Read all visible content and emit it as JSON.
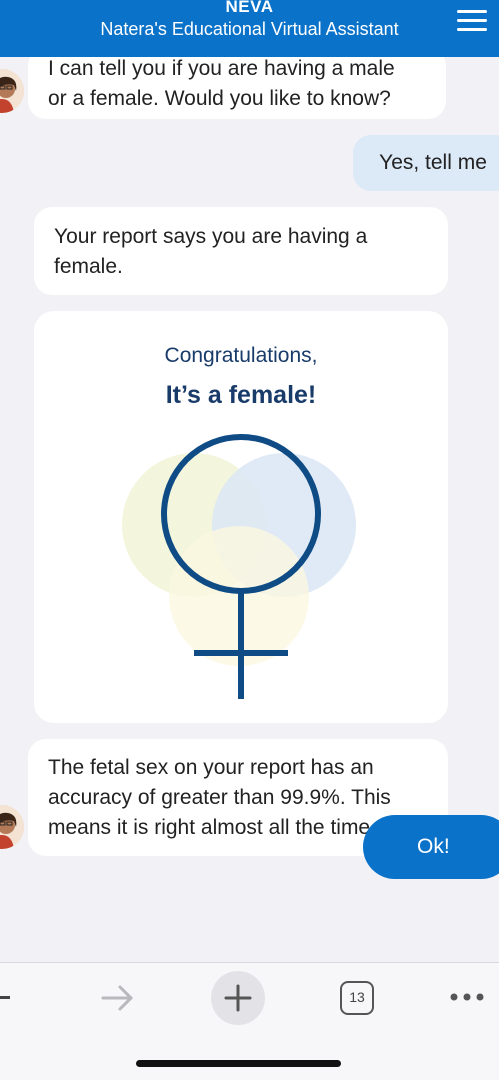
{
  "header": {
    "brand": "NEVA",
    "subtitle": "Natera's Educational Virtual Assistant",
    "menu_icon": "hamburger-menu-icon"
  },
  "messages": {
    "bot_1": {
      "line1": "I can tell you if you are having a male",
      "line2": "or a female. Would you like to know?"
    },
    "user_1": "Yes, tell me",
    "bot_2": {
      "line1": "Your report says you are having a",
      "line2": "female."
    },
    "card": {
      "line1": "Congratulations,",
      "line2": "It’s a female!",
      "icon": "female-symbol-icon"
    },
    "bot_3": {
      "line1": "The fetal sex on your report has an",
      "line2": "accuracy of greater than 99.9%. This",
      "line3": "means it is right almost all the time."
    },
    "ok_button": "Ok!"
  },
  "toolbar": {
    "tab_count": "13",
    "icons": [
      "back-icon",
      "forward-icon",
      "new-tab-icon",
      "tabs-icon",
      "more-icon"
    ]
  },
  "colors": {
    "header_bg": "#0a72c9",
    "user_bubble": "#dce9f7",
    "card_title": "#183b6a",
    "symbol_stroke": "#0f4b85"
  }
}
